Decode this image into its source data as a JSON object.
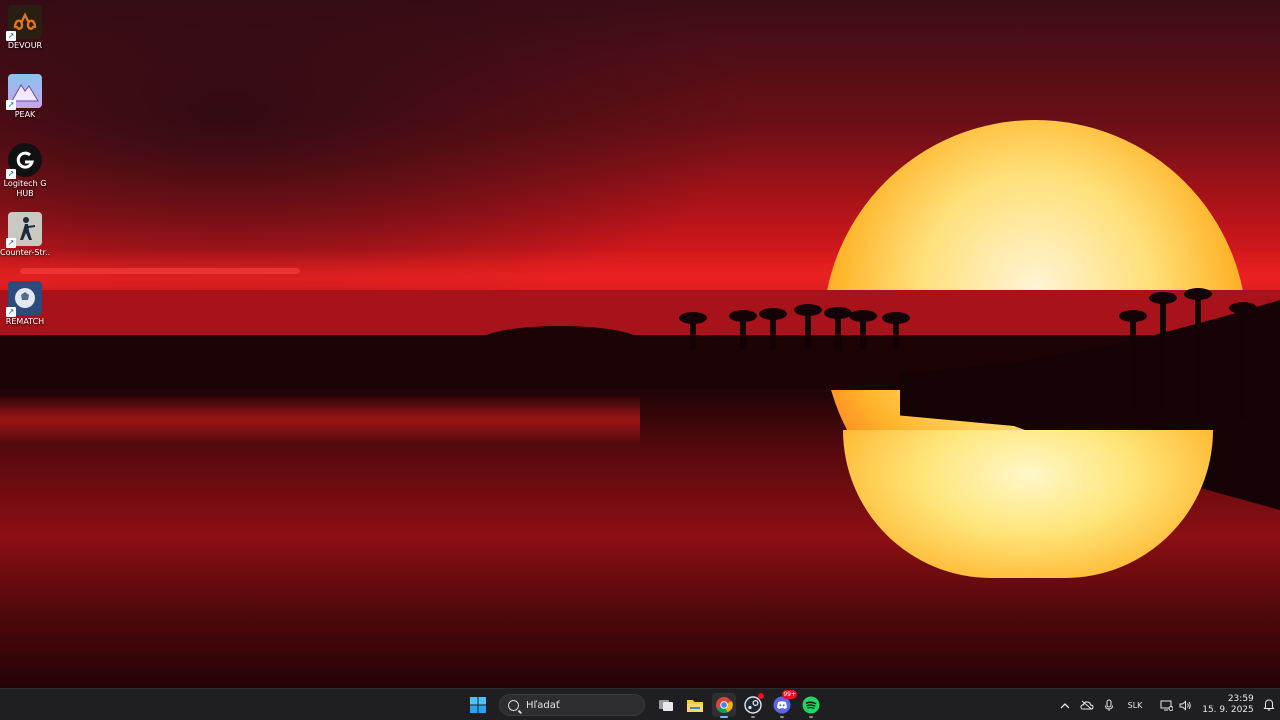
{
  "desktop": {
    "icons": [
      {
        "label": "DEVOUR",
        "icon": "devour-icon",
        "color": "#2a1d12",
        "accent": "#e3741d"
      },
      {
        "label": "PEAK",
        "icon": "peak-mountain-icon",
        "color": "#8ac3ef",
        "accent": "#f3e9ff"
      },
      {
        "label": "Logitech G HUB",
        "icon": "logitech-g-icon",
        "color": "#111111",
        "accent": "#ffffff"
      },
      {
        "label": "Counter-Str...",
        "icon": "counter-strike-icon",
        "color": "#c9c9c2",
        "accent": "#1c2a3d"
      },
      {
        "label": "REMATCH",
        "icon": "rematch-ball-icon",
        "color": "#2e4a7a",
        "accent": "#dfe8f3"
      }
    ]
  },
  "taskbar": {
    "start_icon": "windows-start-icon",
    "search": {
      "placeholder": "Hľadať"
    },
    "apps": [
      {
        "name": "task-view",
        "icon": "task-view-icon",
        "active": false
      },
      {
        "name": "file-explorer",
        "icon": "folder-icon",
        "active": false
      },
      {
        "name": "chrome",
        "icon": "chrome-icon",
        "active": true
      },
      {
        "name": "steam",
        "icon": "steam-icon",
        "active": false,
        "badge_color": "#e81123"
      },
      {
        "name": "discord",
        "icon": "discord-icon",
        "active": false,
        "badge": "99+"
      },
      {
        "name": "spotify",
        "icon": "spotify-icon",
        "active": false
      }
    ],
    "tray": {
      "overflow_icon": "chevron-up-icon",
      "language": "SLK",
      "time": "23:59",
      "date": "15. 9. 2025"
    }
  },
  "colors": {
    "taskbar_bg": "#1f1f22",
    "accent": "#6cc0ff"
  }
}
